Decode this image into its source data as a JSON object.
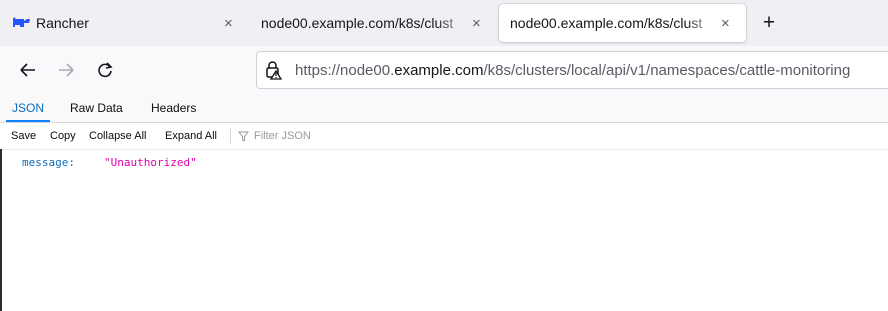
{
  "browser": {
    "tabs": [
      {
        "title": "Rancher",
        "icon": "rancher-logo-icon",
        "active": false
      },
      {
        "title": "node00.example.com/k8s/clust",
        "active": false
      },
      {
        "title": "node00.example.com/k8s/clust",
        "active": true
      }
    ],
    "close_glyph": "×",
    "new_tab_glyph": "+",
    "url": {
      "prefix": "https://node00.",
      "domain": "example.com",
      "path": "/k8s/clusters/local/api/v1/namespaces/cattle-monitoring"
    }
  },
  "viewer": {
    "tabs": [
      "JSON",
      "Raw Data",
      "Headers"
    ],
    "active_tab": "JSON",
    "toolbar": [
      "Save",
      "Copy",
      "Collapse All",
      "Expand All"
    ],
    "filter_placeholder": "Filter JSON",
    "rows": [
      {
        "key": "message:",
        "value": "\"Unauthorized\""
      }
    ]
  },
  "colors": {
    "accent": "#0a84ff",
    "json_key": "#0a6dbe",
    "json_string": "#dd00a9",
    "rancher_blue": "#2453ff"
  }
}
